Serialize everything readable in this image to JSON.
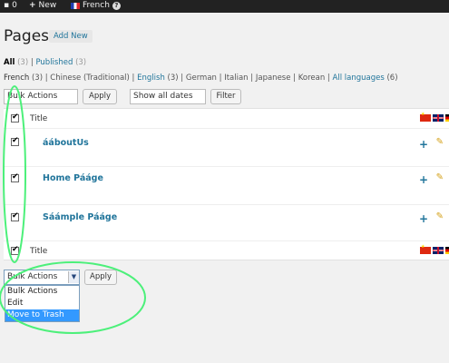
{
  "adminbar": {
    "comments_count": "0",
    "new_label": "New",
    "language_label": "French",
    "help_label": "?"
  },
  "page": {
    "title": "Pages",
    "add_new": "Add New"
  },
  "filters": {
    "all_label": "All",
    "all_count": "(3)",
    "published_label": "Published",
    "published_count": "(3)"
  },
  "languages": [
    {
      "label": "French",
      "count": "(3)",
      "current": true
    },
    {
      "label": "Chinese (Traditional)",
      "count": ""
    },
    {
      "label": "English",
      "count": "(3)",
      "link": true
    },
    {
      "label": "German",
      "count": ""
    },
    {
      "label": "Italian",
      "count": ""
    },
    {
      "label": "Japanese",
      "count": ""
    },
    {
      "label": "Korean",
      "count": ""
    },
    {
      "label": "All languages",
      "count": "(6)",
      "link": true
    }
  ],
  "top_actions": {
    "bulk_label": "Bulk Actions",
    "apply": "Apply",
    "dates": "Show all dates",
    "filter": "Filter"
  },
  "table": {
    "header_title": "Title",
    "footer_title": "Title",
    "rows": [
      {
        "title": "ááboutUs"
      },
      {
        "title": "Home Pááge"
      },
      {
        "title": "Sáámple Pááge"
      }
    ]
  },
  "bottom_actions": {
    "bulk_label": "Bulk Actions",
    "apply": "Apply"
  },
  "dropdown": {
    "options": [
      "Bulk Actions",
      "Edit",
      "Move to Trash"
    ],
    "selected": "Move to Trash"
  },
  "colors": {
    "link": "#21759b",
    "highlight": "#3399ff",
    "annotation": "#4cf07a"
  }
}
